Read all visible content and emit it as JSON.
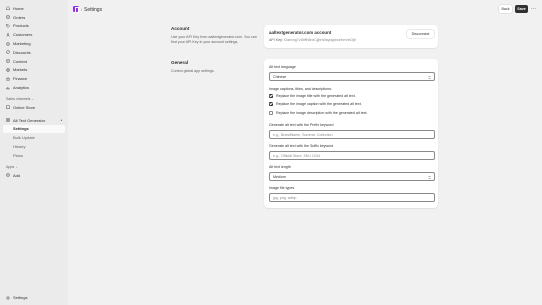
{
  "sidebar": {
    "items": [
      {
        "label": "Home",
        "icon": "home-icon"
      },
      {
        "label": "Orders",
        "icon": "orders-icon"
      },
      {
        "label": "Products",
        "icon": "tag-icon"
      },
      {
        "label": "Customers",
        "icon": "person-icon"
      },
      {
        "label": "Marketing",
        "icon": "target-icon"
      },
      {
        "label": "Discounts",
        "icon": "discount-icon"
      },
      {
        "label": "Content",
        "icon": "content-icon"
      },
      {
        "label": "Markets",
        "icon": "globe-icon"
      },
      {
        "label": "Finance",
        "icon": "bank-icon"
      },
      {
        "label": "Analytics",
        "icon": "analytics-icon"
      }
    ],
    "sales_channels_label": "Sales channels",
    "online_store_label": "Online Store",
    "app_name": "Alt Text Generator",
    "app_subitems": [
      {
        "label": "Settings",
        "active": true
      },
      {
        "label": "Bulk Update",
        "active": false
      },
      {
        "label": "History",
        "active": false
      },
      {
        "label": "Plans",
        "active": false
      }
    ],
    "apps_label": "Apps",
    "add_label": "Add",
    "settings_label": "Settings"
  },
  "topbar": {
    "separator": "/",
    "title": "Settings",
    "back_label": "Back",
    "save_label": "Save",
    "more_label": "···"
  },
  "account": {
    "title": "Account",
    "description": "Use your API Key from aaltextgenerator.com. You can find your API Key in your account settings.",
    "account_name": "aaltextgenerator.com account",
    "api_key_prefix": "API Key:",
    "api_key_value": "f2aexng7v4bffh8nxCjjbnWayogcbuhhrnrixOjb",
    "disconnect_label": "Disconnect"
  },
  "general": {
    "title": "General",
    "description": "Control global app settings.",
    "language_label": "Alt text language",
    "language_value": "Chinese",
    "captions_label": "Image captions, titles, and descriptions:",
    "checkboxes": [
      {
        "label": "Replace the image title with the generated alt text.",
        "checked": true
      },
      {
        "label": "Replace the image caption with the generated alt text.",
        "checked": true
      },
      {
        "label": "Replace the image description with the generated alt text.",
        "checked": false
      }
    ],
    "prefix_label": "Generate alt text with the Prefix keyword",
    "prefix_placeholder": "e.g., BrandName, Summer Collection",
    "suffix_label": "Generate alt text with the Suffix keyword",
    "suffix_placeholder": "e.g., Official Store, SKU 1234",
    "length_label": "Alt text length",
    "length_value": "Medium",
    "filetype_label": "Image file types",
    "filetype_placeholder": "jpg, png, webp"
  },
  "colors": {
    "accent": "#303030",
    "app_logo": "#9b2ff0",
    "background": "#f1f1f1",
    "sidebar": "#ebebeb"
  }
}
